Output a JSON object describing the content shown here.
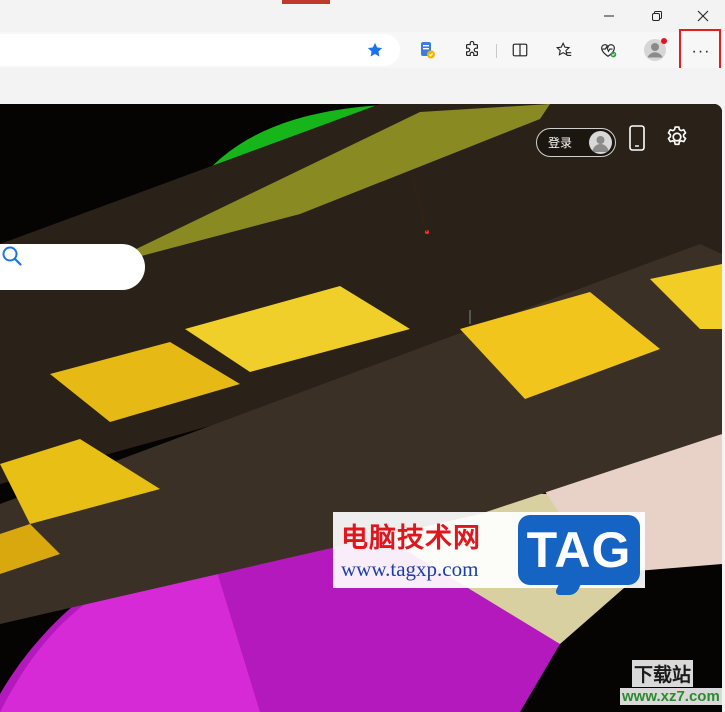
{
  "window": {
    "minimize_icon": "minimize-icon",
    "maximize_icon": "restore-icon",
    "close_icon": "close-icon"
  },
  "toolbar": {
    "favorite_icon": "star-filled-icon",
    "icons": [
      "copilot-icon",
      "extensions-icon",
      "split-screen-icon",
      "favorites-icon",
      "browser-essentials-icon",
      "profile-icon"
    ],
    "more_label": "···",
    "accent": "#1a73e8",
    "highlight_color": "#e02020"
  },
  "hero": {
    "login_label": "登录",
    "phone_icon": "phone-icon",
    "settings_icon": "gear-icon",
    "search_icon": "search-icon"
  },
  "watermark": {
    "line1": "电脑技术网",
    "line2": "www.tagxp.com",
    "tag": "TAG",
    "right1": "下载站",
    "right2": "www.xz7.com"
  }
}
